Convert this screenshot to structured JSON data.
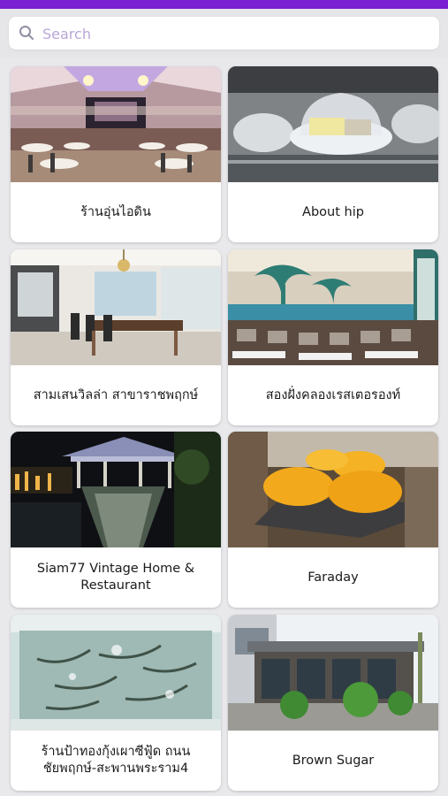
{
  "search": {
    "placeholder": "Search",
    "value": ""
  },
  "colors": {
    "accent": "#7a1fd1",
    "placeholder": "#b9a7d9"
  },
  "restaurants": [
    {
      "name": "ร้านอุ่นไอดิน"
    },
    {
      "name": "About hip"
    },
    {
      "name": "สามเสนวิลล่า สาขาราชพฤกษ์"
    },
    {
      "name": "สองฝั่งคลองเรสเตอรองท์"
    },
    {
      "name": "Siam77 Vintage Home & Restaurant"
    },
    {
      "name": "Faraday"
    },
    {
      "name": "ร้านป้าทองกุ้งเผาซีฟู้ด ถนนชัยพฤกษ์-สะพานพระราม4"
    },
    {
      "name": "Brown Sugar"
    }
  ]
}
